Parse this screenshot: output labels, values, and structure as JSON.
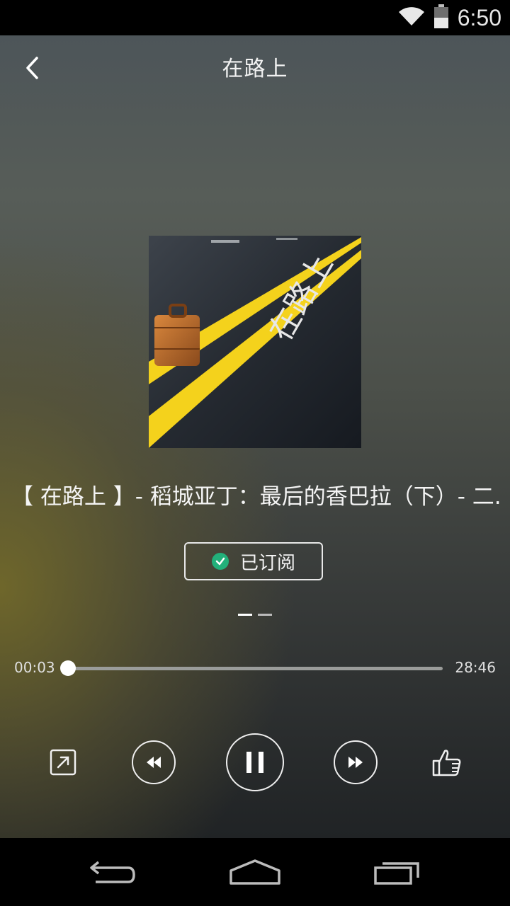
{
  "status_bar": {
    "time": "6:50",
    "icons": [
      "wifi-icon",
      "battery-icon"
    ]
  },
  "header": {
    "title": "在路上",
    "back_icon": "chevron-left-icon"
  },
  "album": {
    "cover_text": "在路上"
  },
  "track": {
    "title": "【 在路上 】- 稻城亚丁：最后的香巴拉（下）- 二..."
  },
  "subscribe": {
    "label": "已订阅",
    "icon": "check-circle-icon"
  },
  "pager": {
    "pages": 2,
    "active": 0
  },
  "player": {
    "current_time": "00:03",
    "total_time": "28:46",
    "progress": 0.002
  },
  "controls": {
    "icons": [
      "share-icon",
      "rewind-icon",
      "pause-icon",
      "fast-forward-icon",
      "thumbs-up-icon"
    ]
  },
  "navigation": {
    "icons": [
      "back-icon",
      "home-icon",
      "recent-apps-icon"
    ]
  },
  "colors": {
    "accent": "#22b07a"
  }
}
